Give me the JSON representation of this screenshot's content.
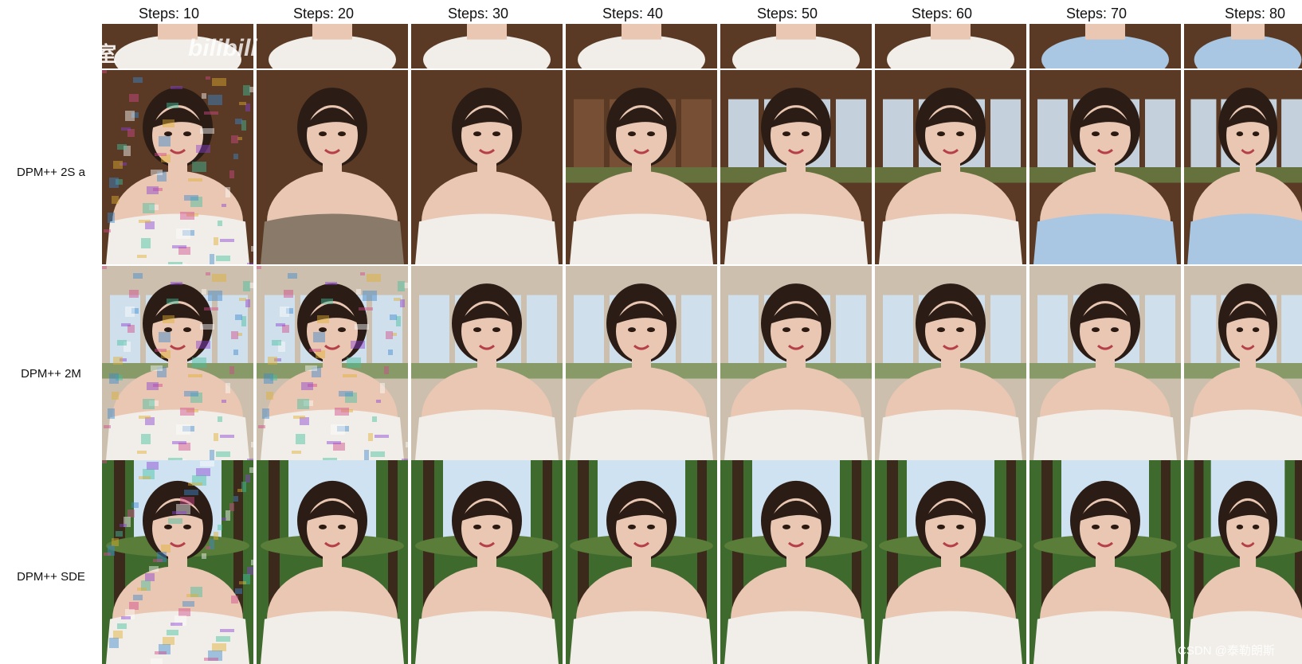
{
  "columns": [
    "Steps: 10",
    "Steps: 20",
    "Steps: 30",
    "Steps: 40",
    "Steps: 50",
    "Steps: 60",
    "Steps: 70",
    "Steps: 80"
  ],
  "rows": [
    "DPM++ 2S a",
    "DPM++ 2M",
    "DPM++ SDE"
  ],
  "watermark_top_left": "Eve实验室",
  "watermark_bilibili": "bilibili",
  "watermark_bottom_right": "CSDN @泰勒朗斯",
  "colors": {
    "background": "#ffffff",
    "skin": "#e9c7b2",
    "hair": "#2b1d16",
    "wood": "#5a3a24",
    "sky": "#cfe2f2",
    "foliage": "#3f6a2e",
    "dress_white": "#f1ede8",
    "dress_blue": "#a9c6e2"
  }
}
